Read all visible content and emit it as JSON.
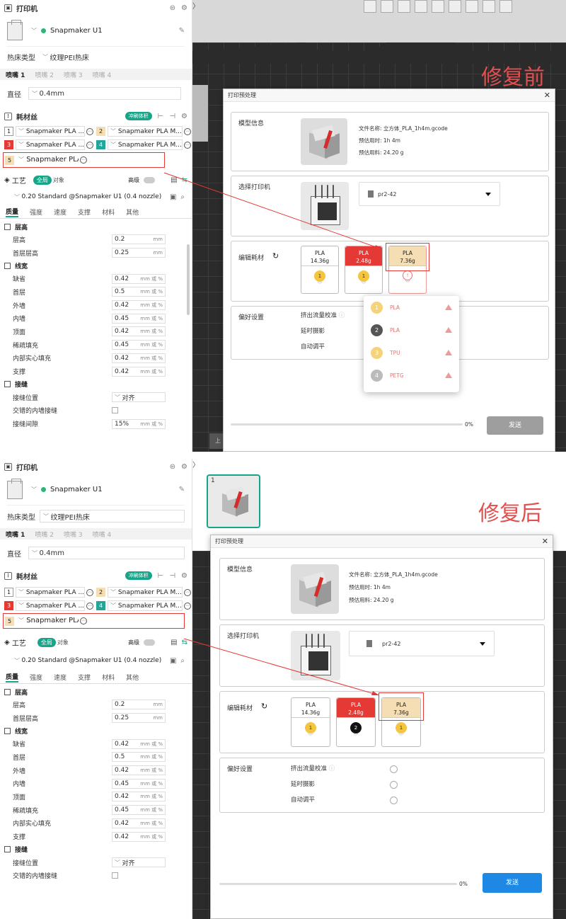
{
  "sidebar": {
    "printer_section": "打印机",
    "printer_name": "Snapmaker U1",
    "bed_label": "热床类型",
    "bed_value": "纹理PEI热床",
    "nozzle_tabs": [
      "喷嘴 1",
      "喷嘴 2",
      "喷嘴 3",
      "喷嘴 4"
    ],
    "diameter_label": "直径",
    "diameter_value": "0.4mm",
    "filament_section": "耗材丝",
    "flush_label": "冲刷体积",
    "filaments": [
      {
        "num": "1",
        "name": "Snapmaker PLA ...",
        "color": "#ffffff"
      },
      {
        "num": "2",
        "name": "Snapmaker PLA M...",
        "color": "#f5deb3"
      },
      {
        "num": "3",
        "name": "Snapmaker PLA ...",
        "color": "#e53935"
      },
      {
        "num": "4",
        "name": "Snapmaker PLA M...",
        "color": "#26a69a"
      },
      {
        "num": "5",
        "name": "Snapmaker PLA ...",
        "color": "#f5deb3"
      }
    ],
    "process_section": "工艺",
    "process_global": "全局",
    "process_object": "对象",
    "advanced": "高级",
    "profile": "0.20 Standard @Snapmaker U1 (0.4 nozzle)",
    "quality_tabs": [
      "质量",
      "强度",
      "速度",
      "支撑",
      "材料",
      "其他"
    ],
    "groups": {
      "layer": "层高",
      "width": "线宽",
      "seam": "接缝"
    },
    "layer_params": [
      {
        "label": "层高",
        "value": "0.2",
        "unit": "mm"
      },
      {
        "label": "首层层高",
        "value": "0.25",
        "unit": "mm"
      }
    ],
    "width_params": [
      {
        "label": "缺省",
        "value": "0.42",
        "unit": "mm 或 %"
      },
      {
        "label": "首层",
        "value": "0.5",
        "unit": "mm 或 %"
      },
      {
        "label": "外墙",
        "value": "0.42",
        "unit": "mm 或 %"
      },
      {
        "label": "内墙",
        "value": "0.45",
        "unit": "mm 或 %"
      },
      {
        "label": "顶面",
        "value": "0.42",
        "unit": "mm 或 %"
      },
      {
        "label": "稀疏填充",
        "value": "0.45",
        "unit": "mm 或 %"
      },
      {
        "label": "内部实心填充",
        "value": "0.42",
        "unit": "mm 或 %"
      },
      {
        "label": "支撑",
        "value": "0.42",
        "unit": "mm 或 %"
      }
    ],
    "seam_position_label": "接缝位置",
    "seam_position_value": "对齐",
    "staggered_label": "交错的内墙接缝",
    "seam_gap_label": "接缝间隙",
    "seam_gap_value": "15%",
    "seam_gap_unit": "mm 或 %"
  },
  "dialog": {
    "title": "打印预处理",
    "model_info_label": "模型信息",
    "file_name": "文件名称: 立方体_PLA_1h4m.gcode",
    "est_time": "预估用时: 1h 4m",
    "est_material_before": "预估用料: 24.20 g",
    "est_material_after": "预估用料: 24.20 g",
    "select_printer_label": "选择打印机",
    "printer_select_value": "pr2-42",
    "edit_filament_label": "编辑耗材",
    "filament_cards": [
      {
        "type": "PLA",
        "weight": "14.36g",
        "color": "#ffffff"
      },
      {
        "type": "PLA",
        "weight": "2.48g",
        "color": "#e53935"
      },
      {
        "type": "PLA",
        "weight": "7.36g",
        "color": "#f5deb3"
      }
    ],
    "before_badges": [
      "1",
      "1",
      ""
    ],
    "after_badges": [
      "1",
      "2",
      "1"
    ],
    "popup_items": [
      {
        "num": "1",
        "name": "PLA",
        "color": "#f5d37a"
      },
      {
        "num": "2",
        "name": "PLA",
        "color": "#555555"
      },
      {
        "num": "3",
        "name": "TPU",
        "color": "#f5d37a"
      },
      {
        "num": "4",
        "name": "PETG",
        "color": "#bbbbbb"
      }
    ],
    "preferences_label": "偏好设置",
    "pref_items": [
      "挤出流量校准",
      "延时摄影",
      "自动调平"
    ],
    "progress_text": "0%",
    "progress_value": 0,
    "send_label": "发送",
    "send_color_disabled": "#9e9e9e",
    "send_color_enabled": "#1e88e5"
  },
  "captions": {
    "before": "修复前",
    "after": "修复后"
  },
  "thumbnail_number": "1",
  "bed_plate_label": "上",
  "accent": "#17a589"
}
